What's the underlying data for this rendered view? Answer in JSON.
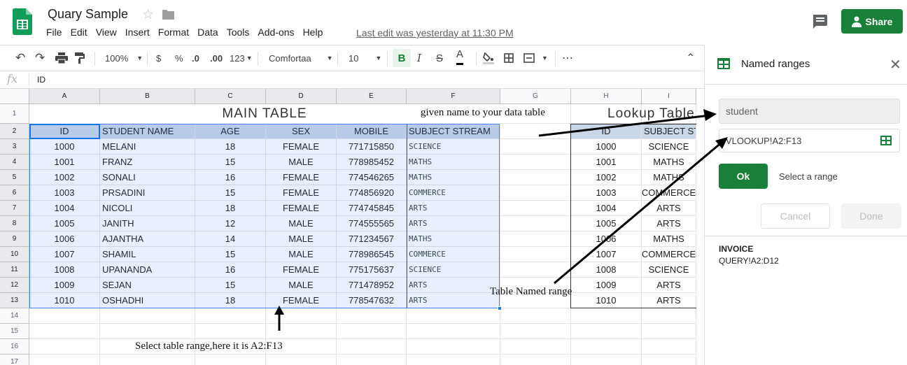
{
  "app": {
    "doc_title": "Quary Sample",
    "menu": [
      "File",
      "Edit",
      "View",
      "Insert",
      "Format",
      "Data",
      "Tools",
      "Add-ons",
      "Help"
    ],
    "last_edit": "Last edit was yesterday at 11:30 PM",
    "share_label": "Share",
    "brand_color": "#188038"
  },
  "toolbar": {
    "zoom": "100%",
    "currency": "$",
    "percent": "%",
    "dec_decrease": ".0",
    "dec_increase": ".00",
    "more_formats": "123",
    "font": "Comfortaa",
    "font_size": "10",
    "bold": "B",
    "italic": "I",
    "strike": "S",
    "text_color": "A",
    "more": "⋯"
  },
  "formula_bar": {
    "fx": "fx",
    "content": "ID"
  },
  "grid": {
    "columns": [
      "A",
      "B",
      "C",
      "D",
      "E",
      "F",
      "G",
      "H",
      "I"
    ],
    "rows": [
      "1",
      "2",
      "3",
      "4",
      "5",
      "6",
      "7",
      "8",
      "9",
      "10",
      "11",
      "12",
      "13",
      "14",
      "15",
      "16",
      "17"
    ],
    "main_title": "MAIN TABLE",
    "lookup_title": "Lookup Table",
    "headers": [
      "ID",
      "STUDENT NAME",
      "AGE",
      "SEX",
      "MOBILE",
      "SUBJECT STREAM"
    ],
    "lookup_headers": [
      "ID",
      "SUBJECT STREAM"
    ],
    "data": [
      [
        "1000",
        "MELANI",
        "18",
        "FEMALE",
        "771715850",
        "SCIENCE"
      ],
      [
        "1001",
        "FRANZ",
        "15",
        "MALE",
        "778985452",
        "MATHS"
      ],
      [
        "1002",
        "SONALI",
        "16",
        "FEMALE",
        "774546265",
        "MATHS"
      ],
      [
        "1003",
        "PRSADINI",
        "15",
        "FEMALE",
        "774856920",
        "COMMERCE"
      ],
      [
        "1004",
        "NICOLI",
        "18",
        "FEMALE",
        "774745845",
        "ARTS"
      ],
      [
        "1005",
        "JANITH",
        "12",
        "MALE",
        "774555565",
        "ARTS"
      ],
      [
        "1006",
        "AJANTHA",
        "14",
        "MALE",
        "771234567",
        "MATHS"
      ],
      [
        "1007",
        "SHAMIL",
        "15",
        "MALE",
        "778986545",
        "COMMERCE"
      ],
      [
        "1008",
        "UPANANDA",
        "16",
        "FEMALE",
        "775175637",
        "SCIENCE"
      ],
      [
        "1009",
        "SEJAN",
        "15",
        "MALE",
        "771478952",
        "ARTS"
      ],
      [
        "1010",
        "OSHADHI",
        "18",
        "FEMALE",
        "778547632",
        "ARTS"
      ]
    ],
    "lookup_data": [
      [
        "1000",
        "SCIENCE"
      ],
      [
        "1001",
        "MATHS"
      ],
      [
        "1002",
        "MATHS"
      ],
      [
        "1003",
        "COMMERCE"
      ],
      [
        "1004",
        "ARTS"
      ],
      [
        "1005",
        "ARTS"
      ],
      [
        "1006",
        "MATHS"
      ],
      [
        "1007",
        "COMMERCE"
      ],
      [
        "1008",
        "SCIENCE"
      ],
      [
        "1009",
        "ARTS"
      ],
      [
        "1010",
        "ARTS"
      ]
    ]
  },
  "annotations": {
    "given_name": "given name to your data table",
    "named_range": "Table Named range",
    "select_range": "Select table range,here it is A2:F13"
  },
  "panel": {
    "title": "Named ranges",
    "name_value": "student",
    "range_value": "VLOOKUP!A2:F13",
    "ok_label": "Ok",
    "select_hint": "Select a range",
    "cancel_label": "Cancel",
    "done_label": "Done",
    "ranges": [
      {
        "name": "INVOICE",
        "ref": "QUERY!A2:D12"
      }
    ]
  }
}
